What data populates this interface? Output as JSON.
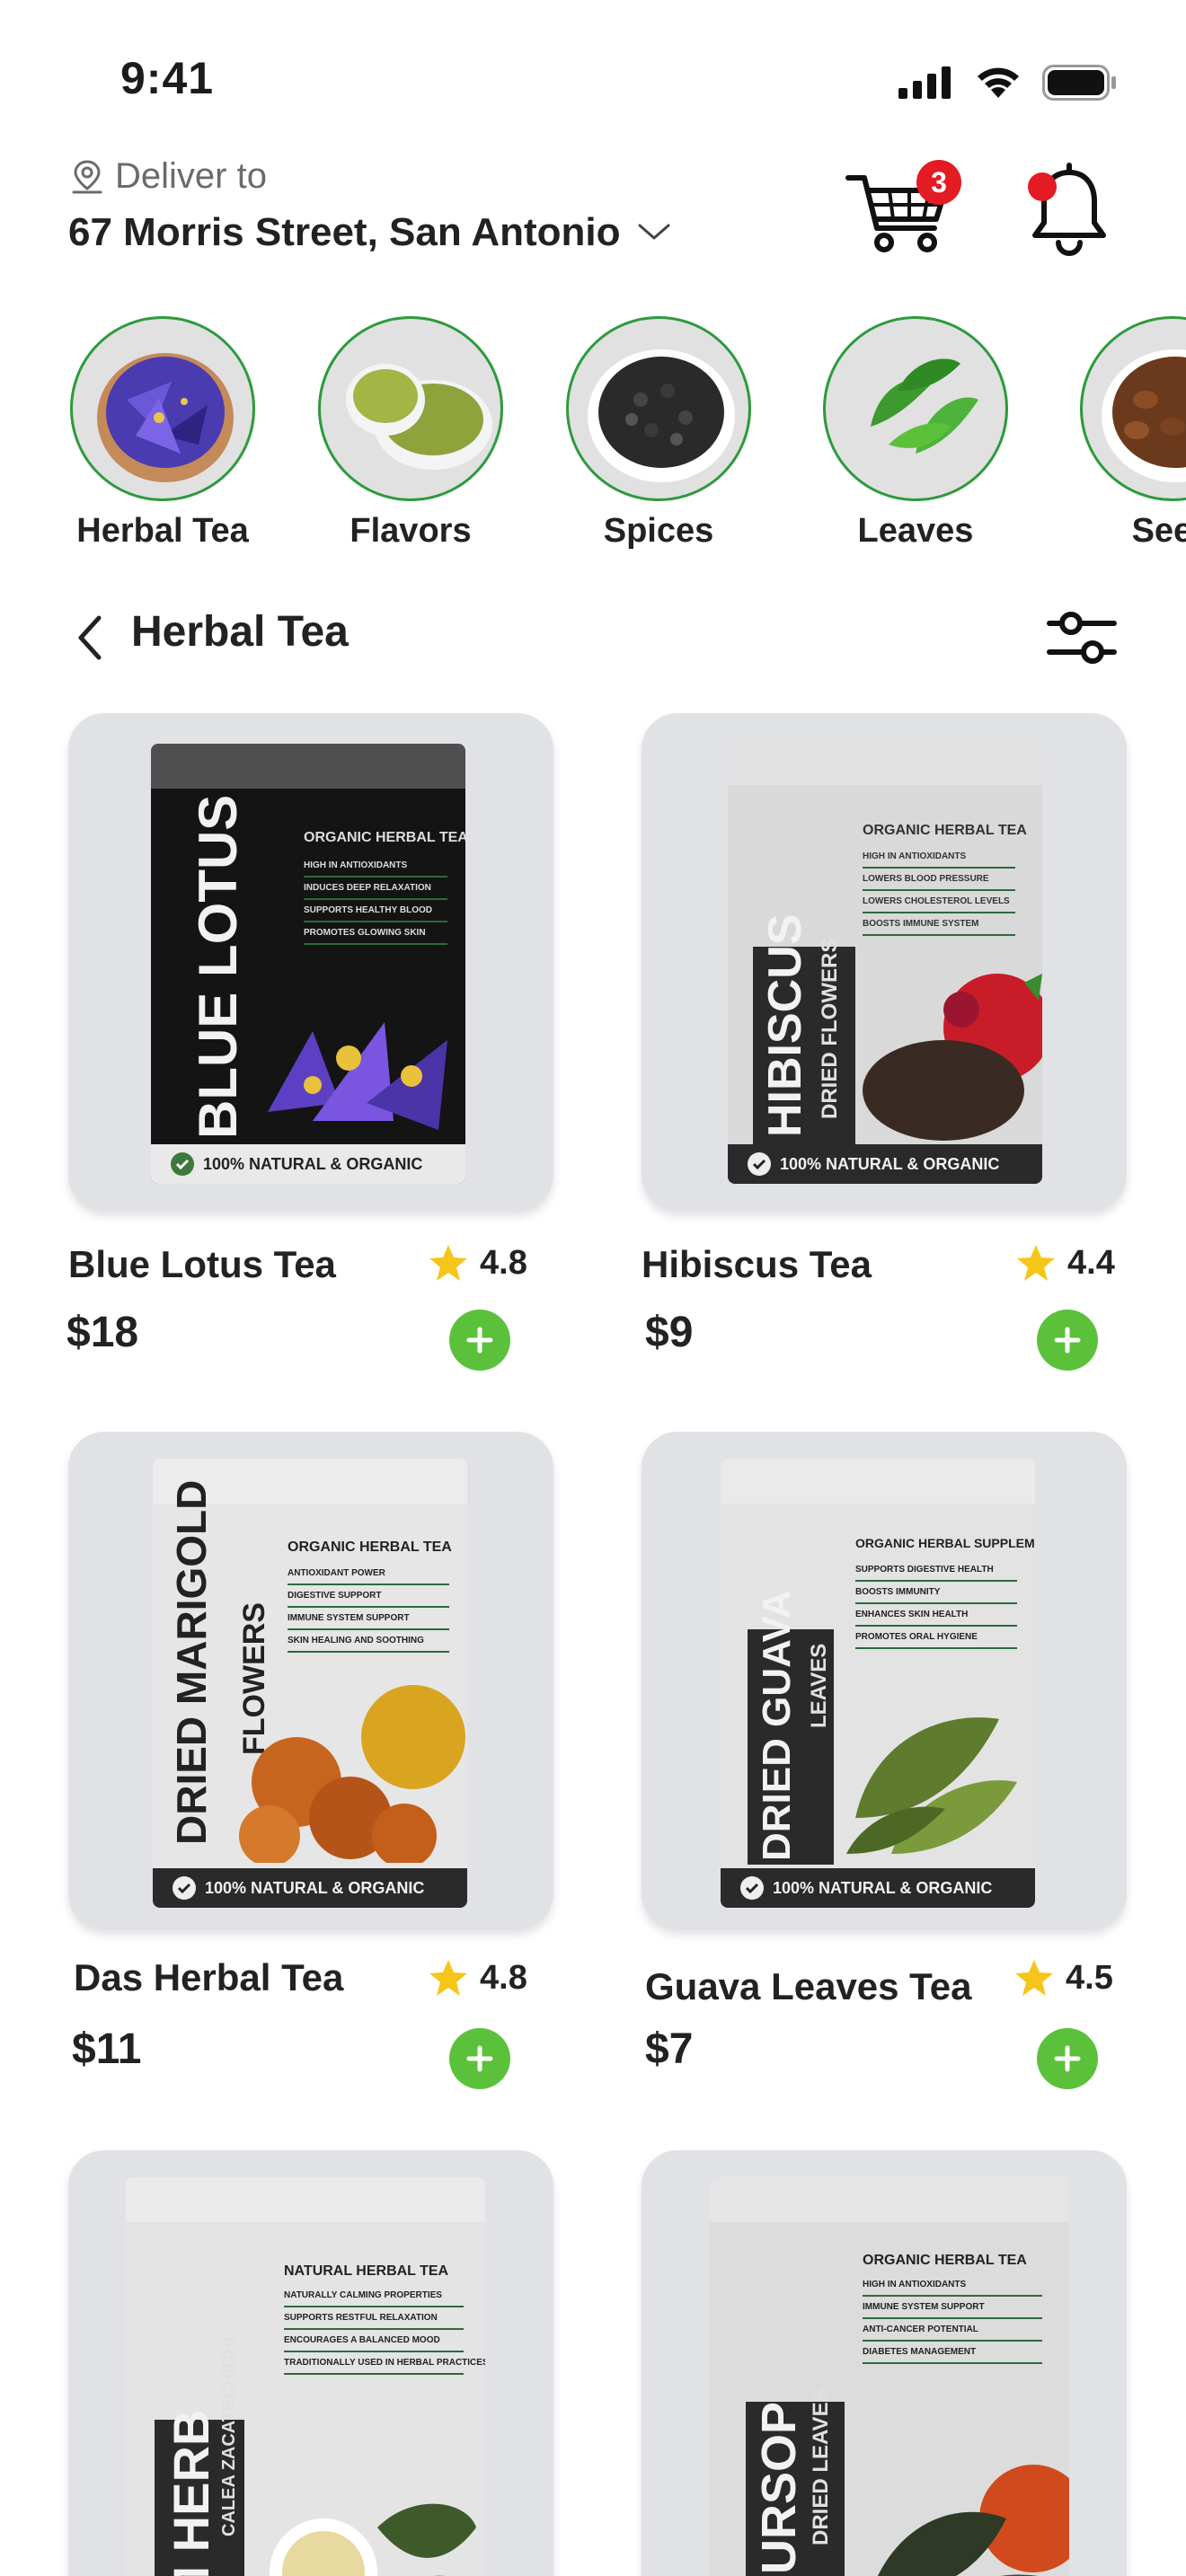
{
  "status_bar": {
    "time": "9:41"
  },
  "header": {
    "deliver_label": "Deliver to",
    "address": "67 Morris Street, San Antonio",
    "cart_count": "3",
    "icons": {
      "location": "location-pin-icon",
      "chevron": "chevron-down-icon",
      "cart": "cart-icon",
      "bell": "bell-icon"
    },
    "colors": {
      "badge": "#e31b23",
      "accent_green": "#5cc13a",
      "circle_border": "#2e9a3e"
    }
  },
  "categories": [
    {
      "label": "Herbal Tea"
    },
    {
      "label": "Flavors"
    },
    {
      "label": "Spices"
    },
    {
      "label": "Leaves"
    },
    {
      "label": "Seed"
    }
  ],
  "section": {
    "title": "Herbal Tea"
  },
  "products": [
    {
      "name": "Blue Lotus Tea",
      "rating": "4.8",
      "price": "$18",
      "pkg_title": "BLUE LOTUS",
      "pkg_subtitle": "",
      "pkg_heading": "ORGANIC HERBAL TEA",
      "pkg_bullets": [
        "HIGH IN ANTIOXIDANTS",
        "INDUCES DEEP RELAXATION",
        "SUPPORTS HEALTHY BLOOD",
        "PROMOTES GLOWING SKIN"
      ],
      "pkg_footer": "100% NATURAL & ORGANIC"
    },
    {
      "name": "Hibiscus Tea",
      "rating": "4.4",
      "price": "$9",
      "pkg_title": "HIBISCUS",
      "pkg_subtitle": "DRIED FLOWERS",
      "pkg_heading": "ORGANIC HERBAL TEA",
      "pkg_bullets": [
        "HIGH IN ANTIOXIDANTS",
        "LOWERS BLOOD PRESSURE",
        "LOWERS CHOLESTEROL LEVELS",
        "BOOSTS IMMUNE SYSTEM"
      ],
      "pkg_footer": "100% NATURAL & ORGANIC"
    },
    {
      "name": "Das Herbal Tea",
      "rating": "4.8",
      "price": "$11",
      "pkg_title": "DRIED MARIGOLD",
      "pkg_subtitle": "FLOWERS",
      "pkg_heading": "ORGANIC HERBAL TEA",
      "pkg_bullets": [
        "ANTIOXIDANT POWER",
        "DIGESTIVE SUPPORT",
        "IMMUNE SYSTEM SUPPORT",
        "SKIN HEALING AND SOOTHING"
      ],
      "pkg_footer": "100% NATURAL & ORGANIC"
    },
    {
      "name": "Guava Leaves Tea",
      "rating": "4.5",
      "price": "$7",
      "pkg_title": "DRIED GUAVA",
      "pkg_subtitle": "LEAVES",
      "pkg_heading": "ORGANIC HERBAL SUPPLEMENT",
      "pkg_bullets": [
        "SUPPORTS DIGESTIVE HEALTH",
        "BOOSTS IMMUNITY",
        "ENHANCES SKIN HEALTH",
        "PROMOTES ORAL HYGIENE"
      ],
      "pkg_footer": "100% NATURAL & ORGANIC"
    },
    {
      "name": "",
      "rating": "",
      "price": "",
      "pkg_title": "AM HERB",
      "pkg_subtitle": "CALEA ZACATECHICHI",
      "pkg_heading": "NATURAL HERBAL TEA",
      "pkg_bullets": [
        "NATURALLY CALMING PROPERTIES",
        "SUPPORTS RESTFUL RELAXATION",
        "ENCOURAGES A BALANCED MOOD",
        "TRADITIONALLY USED IN HERBAL PRACTICES"
      ],
      "pkg_footer": ""
    },
    {
      "name": "",
      "rating": "",
      "price": "",
      "pkg_title": "SOURSOP",
      "pkg_subtitle": "DRIED LEAVES",
      "pkg_heading": "ORGANIC HERBAL TEA",
      "pkg_bullets": [
        "HIGH IN ANTIOXIDANTS",
        "IMMUNE SYSTEM SUPPORT",
        "ANTI-CANCER POTENTIAL",
        "DIABETES MANAGEMENT"
      ],
      "pkg_footer": ""
    }
  ]
}
